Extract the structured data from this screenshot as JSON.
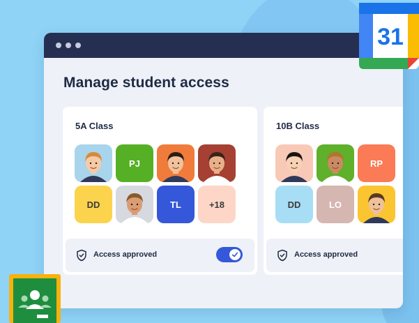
{
  "page": {
    "title": "Manage student access"
  },
  "colors": {
    "background": "#8fd3f7",
    "titlebar": "#252f52",
    "toggle_on": "#3557d9",
    "text": "#1f2a44"
  },
  "classes": [
    {
      "name": "5A Class",
      "status": "Access approved",
      "toggle_on": true,
      "students": [
        {
          "type": "photo",
          "icon": "student-photo",
          "bg": "#a8d4ec"
        },
        {
          "type": "initials",
          "initials": "PJ",
          "bg": "#55b025",
          "fg": "#ffffff"
        },
        {
          "type": "photo",
          "icon": "student-photo",
          "bg": "#f07b3a"
        },
        {
          "type": "photo",
          "icon": "student-photo",
          "bg": "#a54032"
        },
        {
          "type": "initials",
          "initials": "DD",
          "bg": "#fcd34d",
          "fg": "#3b3b3b"
        },
        {
          "type": "photo",
          "icon": "student-photo",
          "bg": "#d6d9e0"
        },
        {
          "type": "initials",
          "initials": "TL",
          "bg": "#3557d9",
          "fg": "#ffffff"
        },
        {
          "type": "initials",
          "initials": "+18",
          "bg": "#fdd6c8",
          "fg": "#3b3b3b"
        }
      ]
    },
    {
      "name": "10B Class",
      "status": "Access approved",
      "students": [
        {
          "type": "photo",
          "icon": "student-photo",
          "bg": "#f8c9b6"
        },
        {
          "type": "photo",
          "icon": "student-photo",
          "bg": "#5fb02a"
        },
        {
          "type": "initials",
          "initials": "RP",
          "bg": "#fa7b55",
          "fg": "#ffffff"
        },
        {
          "type": "blank"
        },
        {
          "type": "initials",
          "initials": "DD",
          "bg": "#a8def5",
          "fg": "#3b3b3b"
        },
        {
          "type": "initials",
          "initials": "LO",
          "bg": "#d6b6b0",
          "fg": "#ffffff"
        },
        {
          "type": "photo",
          "icon": "student-photo",
          "bg": "#fbc531"
        },
        {
          "type": "blank"
        }
      ]
    }
  ],
  "apps": {
    "calendar": {
      "label": "31",
      "icon": "google-calendar-icon"
    },
    "classroom": {
      "icon": "google-classroom-icon"
    }
  }
}
